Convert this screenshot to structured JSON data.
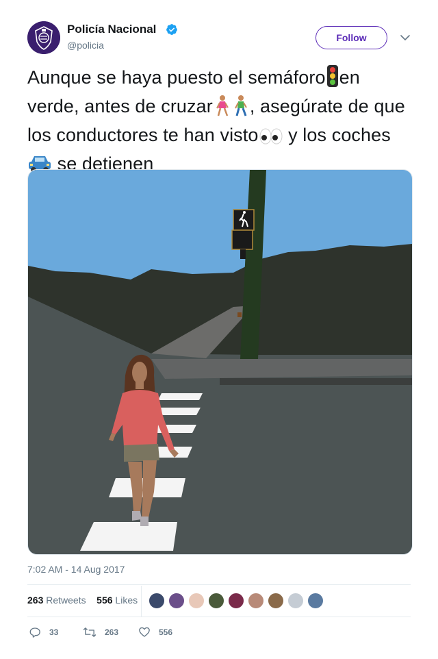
{
  "account": {
    "name": "Policía Nacional",
    "handle": "@policia",
    "follow_label": "Follow",
    "brand_color": "#5b2bb7",
    "verified_color": "#1da1f2"
  },
  "tweet": {
    "text_parts": {
      "p1": "Aunque se haya puesto el semáforo",
      "p2": "en verde, antes de cruzar",
      "p3": ", asegúrate de que los conductores te han visto",
      "p4": " y los coches",
      "p5": " se detienen"
    },
    "emojis": [
      "traffic-light-icon",
      "woman-walking-icon",
      "man-walking-icon",
      "eyes-icon",
      "car-icon"
    ],
    "timestamp": "7:02 AM - 14 Aug 2017"
  },
  "stats": {
    "retweets_count": "263",
    "retweets_label": "Retweets",
    "likes_count": "556",
    "likes_label": "Likes"
  },
  "actions": {
    "reply_count": "33",
    "retweet_count": "263",
    "like_count": "556"
  },
  "liker_avatar_colors": [
    "#3b4a6b",
    "#6b4f8a",
    "#e8c8b8",
    "#4a5a3a",
    "#7a2a4a",
    "#b88a78",
    "#8a6a4a",
    "#c5ccd4",
    "#5a7aa0"
  ]
}
